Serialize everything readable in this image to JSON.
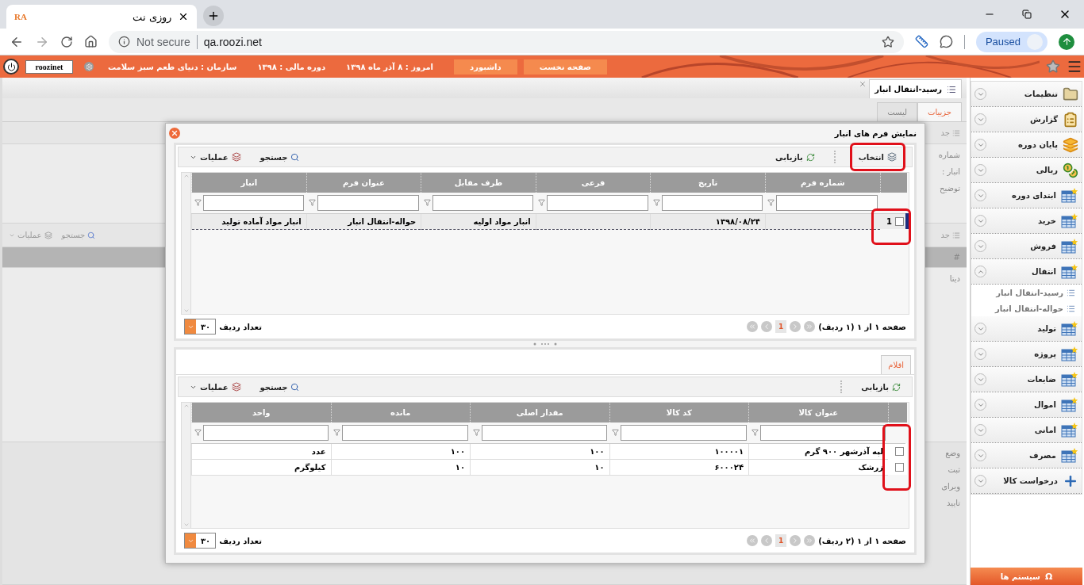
{
  "browser": {
    "tab_logo": "RA",
    "tab_title": "روزی نت",
    "security": "Not secure",
    "url": "qa.roozi.net",
    "profile": "Paused"
  },
  "app_bar": {
    "user": "roozinet",
    "items": [
      {
        "kind": "button",
        "text": "صفحه نخست"
      },
      {
        "kind": "button",
        "text": "داشبورد"
      },
      {
        "kind": "info",
        "text": "امروز : ۸ آذر ماه ۱۳۹۸"
      },
      {
        "kind": "info",
        "text": "دوره مالی : ۱۳۹۸"
      },
      {
        "kind": "info",
        "text": "سازمان : دنیای طعم سبز سلامت"
      }
    ]
  },
  "page_tab": {
    "title": "رسید-انتقال انبار"
  },
  "sub_tabs": [
    {
      "label": "جزییات",
      "selected": true
    },
    {
      "label": "لیست",
      "selected": false
    }
  ],
  "background": {
    "section_titles": [
      "جد",
      "جد"
    ],
    "fields": [
      "شماره",
      "انبار :",
      "توضیح"
    ],
    "toolbar": [
      "جستجو",
      "عملیات"
    ],
    "grid_header": "#",
    "grid_cell": "دیتا",
    "status_labels": [
      "وضع",
      "ثبت",
      "ویرای",
      "تایید"
    ]
  },
  "dialog": {
    "title": "نمایش فرم های انبار",
    "forms": {
      "toolbar_right": [
        "انتخاب",
        "بازیابی"
      ],
      "search": "جستجو",
      "actions": "عملیات",
      "columns": [
        "شماره فرم",
        "تاریخ",
        "فرعی",
        "طرف مقابل",
        "عنوان فرم",
        "انبار"
      ],
      "rows": [
        {
          "number": "1",
          "selected": true,
          "checked": false,
          "cells": [
            "",
            "۱۳۹۸/۰۸/۲۴",
            "",
            "انبار مواد اولیه",
            "حواله-انتقال انبار",
            "انبار مواد آماده تولید"
          ]
        }
      ],
      "pager": {
        "summary": "صفحه ۱ از ۱ (۱ ردیف)",
        "page": "1",
        "page_size": "۳۰",
        "page_size_label": "تعداد ردیف"
      }
    },
    "items_tab": {
      "label": "اقلام",
      "selected": true
    },
    "items": {
      "toolbar_right": [
        "بازیابی"
      ],
      "search": "جستجو",
      "actions": "عملیات",
      "columns": [
        "عنوان کالا",
        "کد کالا",
        "مقدار اصلی",
        "مانده",
        "واحد"
      ],
      "rows": [
        {
          "selected": false,
          "checked": false,
          "cells": [
            "لپه آذرشهر ۹۰۰ گرم",
            "۱۰۰۰۰۱",
            "۱۰۰",
            "۱۰۰",
            "عدد"
          ]
        },
        {
          "selected": false,
          "checked": false,
          "cells": [
            "زرشک",
            "۶۰۰۰۲۴",
            "۱۰",
            "۱۰",
            "کیلوگرم"
          ]
        }
      ],
      "pager": {
        "summary": "صفحه ۱ از ۱ (۲ ردیف)",
        "page": "1",
        "page_size": "۳۰",
        "page_size_label": "تعداد ردیف"
      }
    }
  },
  "sidebar": {
    "items": [
      {
        "label": "تنظیمات",
        "kind": "folder",
        "expanded": false
      },
      {
        "label": "گزارش",
        "kind": "clipboard",
        "expanded": false
      },
      {
        "label": "پایان دوره",
        "kind": "stack",
        "expanded": false
      },
      {
        "label": "ریالی",
        "kind": "coins",
        "expanded": false
      },
      {
        "label": "ابتدای دوره",
        "kind": "table",
        "expanded": false
      },
      {
        "label": "خرید",
        "kind": "table",
        "expanded": false
      },
      {
        "label": "فروش",
        "kind": "table",
        "expanded": false
      },
      {
        "label": "انتقال",
        "kind": "table",
        "expanded": true,
        "children": [
          {
            "label": "رسید-انتقال انبار"
          },
          {
            "label": "حواله-انتقال انبار"
          }
        ]
      },
      {
        "label": "تولید",
        "kind": "table",
        "expanded": false
      },
      {
        "label": "پروژه",
        "kind": "table",
        "expanded": false
      },
      {
        "label": "ضایعات",
        "kind": "table",
        "expanded": false
      },
      {
        "label": "اموال",
        "kind": "table",
        "expanded": false
      },
      {
        "label": "امانی",
        "kind": "table",
        "expanded": false
      },
      {
        "label": "مصرف",
        "kind": "table",
        "expanded": false
      },
      {
        "label": "درخواست کالا",
        "kind": "plus",
        "expanded": false
      }
    ],
    "systems_button": {
      "symbol": "Ω",
      "label": "سیستم ها"
    }
  }
}
